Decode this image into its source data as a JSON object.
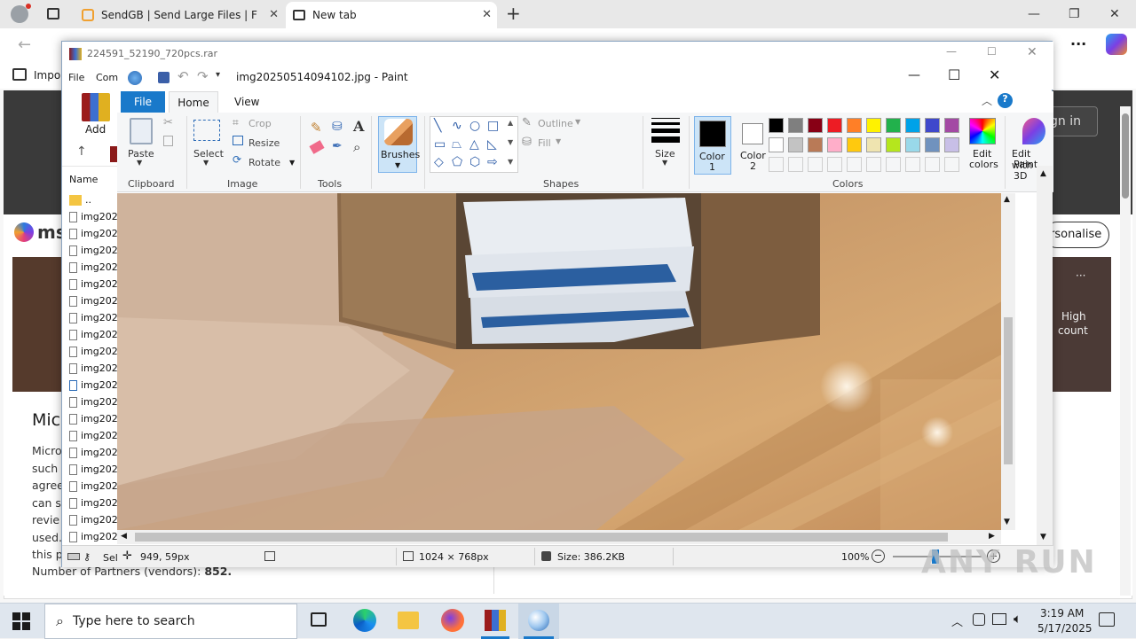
{
  "browser": {
    "tabs": [
      {
        "label": "SendGB | Send Large Files | Free f"
      },
      {
        "label": "New tab"
      }
    ],
    "new_tab_symbol": "+",
    "fav_item": "Impor",
    "sign_in": "gn in",
    "personalise": "rsonalise",
    "msn_logo": "ms",
    "article_title": "Mic",
    "article_lines": [
      "Micro",
      "such",
      "agree",
      "can s",
      "revie",
      "used.",
      "this p"
    ],
    "vendors_text": "Number of Partners (vendors):",
    "vendors_count": "852.",
    "card_side": [
      "High",
      "count"
    ],
    "menu_dots": "···",
    "more_dots": "···"
  },
  "winrar": {
    "title": "224591_52190_720pcs.rar",
    "menu": [
      "File",
      "Com"
    ],
    "add_label": "Add",
    "column_name": "Name",
    "parent_dir": "..",
    "files": [
      "img202",
      "img202",
      "img202",
      "img202",
      "img202",
      "img202",
      "img202",
      "img202",
      "img202",
      "img202",
      "img202",
      "img202",
      "img202",
      "img202",
      "img202",
      "img202",
      "img202",
      "img202",
      "img202",
      "img202"
    ],
    "status": "Sele"
  },
  "paint": {
    "title": "img20250514094102.jpg - Paint",
    "tabs": {
      "file": "File",
      "home": "Home",
      "view": "View"
    },
    "clipboard": {
      "paste": "Paste",
      "label": "Clipboard"
    },
    "image": {
      "select": "Select",
      "crop": "Crop",
      "resize": "Resize",
      "rotate": "Rotate",
      "label": "Image"
    },
    "tools": {
      "label": "Tools"
    },
    "brushes": "Brushes",
    "shapes": {
      "outline": "Outline",
      "fill": "Fill",
      "label": "Shapes"
    },
    "size": "Size",
    "color1": [
      "Color",
      "1"
    ],
    "color2": [
      "Color",
      "2"
    ],
    "colors_label": "Colors",
    "edit_colors": [
      "Edit",
      "colors"
    ],
    "edit_paint3d": [
      "Edit with",
      "Paint 3D"
    ],
    "palette_row1": [
      "#000000",
      "#7f7f7f",
      "#880015",
      "#ed1c24",
      "#ff7f27",
      "#fff200",
      "#22b14c",
      "#00a2e8",
      "#3f48cc",
      "#a349a4"
    ],
    "palette_row2": [
      "#ffffff",
      "#c3c3c3",
      "#b97a57",
      "#ffaec9",
      "#ffc90e",
      "#efe4b0",
      "#b5e61d",
      "#99d9ea",
      "#7092be",
      "#c8bfe7"
    ],
    "status": {
      "position": "949, 59px",
      "dimensions": "1024 × 768px",
      "size": "Size: 386.2KB",
      "zoom": "100%"
    }
  },
  "watermark": "ANY RUN",
  "taskbar": {
    "search_placeholder": "Type here to search",
    "time": "3:19 AM",
    "date": "5/17/2025"
  }
}
